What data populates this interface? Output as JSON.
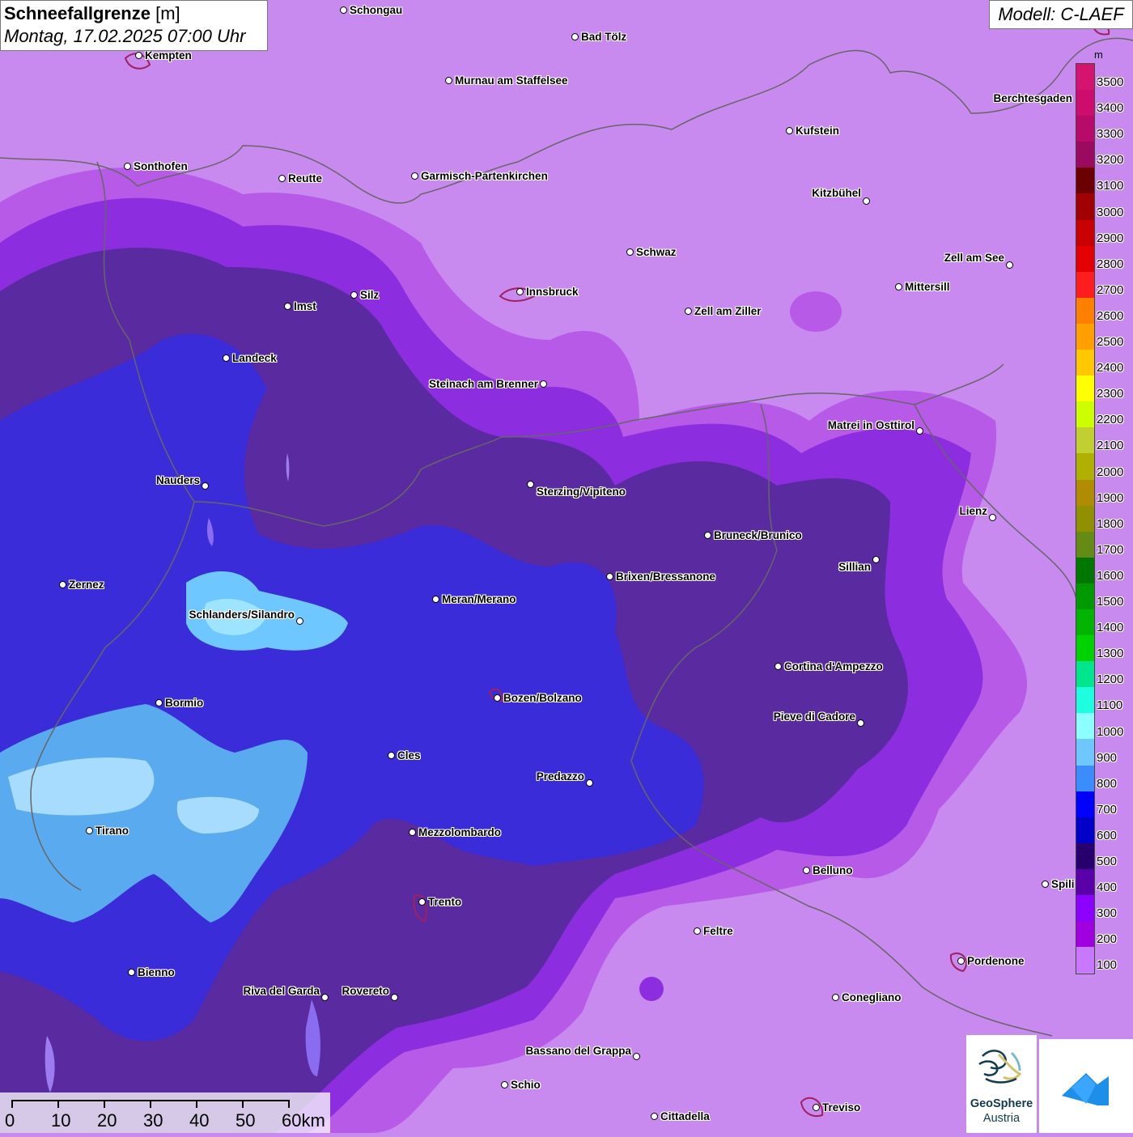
{
  "title": {
    "main": "Schneefallgrenze",
    "unit": "[m]",
    "datetime": "Montag, 17.02.2025 07:00 Uhr"
  },
  "model": "Modell: C-LAEF",
  "legend": {
    "unit": "m",
    "labels": [
      "3500",
      "3400",
      "3300",
      "3200",
      "3100",
      "3000",
      "2900",
      "2800",
      "2700",
      "2600",
      "2500",
      "2400",
      "2300",
      "2200",
      "2100",
      "2000",
      "1900",
      "1800",
      "1700",
      "1600",
      "1500",
      "1400",
      "1300",
      "1200",
      "1100",
      "1000",
      "900",
      "800",
      "700",
      "600",
      "500",
      "400",
      "300",
      "200",
      "100"
    ],
    "colors": [
      "#d4146e",
      "#cc0d6d",
      "#b80a68",
      "#9a0a5e",
      "#6a0000",
      "#a00000",
      "#c80000",
      "#e20000",
      "#ff1d1d",
      "#ff8000",
      "#ffa000",
      "#ffc800",
      "#ffff00",
      "#ccff00",
      "#c0d030",
      "#b0b000",
      "#b08c00",
      "#909000",
      "#648c14",
      "#007800",
      "#009900",
      "#00b400",
      "#00d200",
      "#00e68c",
      "#1effe0",
      "#8cffff",
      "#6ec8ff",
      "#3a8cff",
      "#0000ff",
      "#0000c8",
      "#28006e",
      "#5a00a8",
      "#8c00ff",
      "#a000e0",
      "#c878ff"
    ]
  },
  "scale": {
    "labels": [
      "0",
      "10",
      "20",
      "30",
      "40",
      "50",
      "60km"
    ]
  },
  "cities": [
    {
      "name": "Schongau"
    },
    {
      "name": "Bad Tölz"
    },
    {
      "name": "Kempten"
    },
    {
      "name": "Murnau am Staffelsee"
    },
    {
      "name": "Berchtesgaden"
    },
    {
      "name": "Kufstein"
    },
    {
      "name": "Sonthofen"
    },
    {
      "name": "Reutte"
    },
    {
      "name": "Garmisch-Partenkirchen"
    },
    {
      "name": "Kitzbühel"
    },
    {
      "name": "Schwaz"
    },
    {
      "name": "Zell am See"
    },
    {
      "name": "Mittersill"
    },
    {
      "name": "Imst"
    },
    {
      "name": "Silz"
    },
    {
      "name": "Innsbruck"
    },
    {
      "name": "Zell am Ziller"
    },
    {
      "name": "Landeck"
    },
    {
      "name": "Steinach am Brenner"
    },
    {
      "name": "Matrei in Osttirol"
    },
    {
      "name": "Nauders"
    },
    {
      "name": "Sterzing/Vipiteno"
    },
    {
      "name": "Lienz"
    },
    {
      "name": "Bruneck/Brunico"
    },
    {
      "name": "Sillian"
    },
    {
      "name": "Zernez"
    },
    {
      "name": "Brixen/Bressanone"
    },
    {
      "name": "Meran/Merano"
    },
    {
      "name": "Schlanders/Silandro"
    },
    {
      "name": "Cortina d'Ampezzo"
    },
    {
      "name": "Bozen/Bolzano"
    },
    {
      "name": "Bormio"
    },
    {
      "name": "Pieve di Cadore"
    },
    {
      "name": "Cles"
    },
    {
      "name": "Predazzo"
    },
    {
      "name": "Tirano"
    },
    {
      "name": "Mezzolombardo"
    },
    {
      "name": "Belluno"
    },
    {
      "name": "Spili"
    },
    {
      "name": "Trento"
    },
    {
      "name": "Feltre"
    },
    {
      "name": "Pordenone"
    },
    {
      "name": "Bienno"
    },
    {
      "name": "Riva del Garda"
    },
    {
      "name": "Rovereto"
    },
    {
      "name": "Conegliano"
    },
    {
      "name": "Bassano del Grappa"
    },
    {
      "name": "Schio"
    },
    {
      "name": "Treviso"
    },
    {
      "name": "Cittadella"
    }
  ],
  "logo": {
    "name_line1": "GeoSphere",
    "name_line2": "Austria"
  }
}
